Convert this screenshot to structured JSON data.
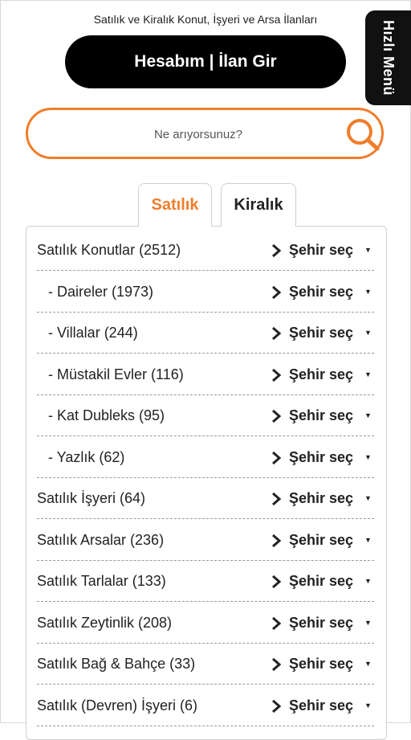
{
  "header": {
    "tagline": "Satılık ve Kiralık Konut, İşyeri ve Arsa İlanları",
    "account_button": "Hesabım | İlan Gir",
    "quick_menu": "Hızlı Menü"
  },
  "search": {
    "placeholder": "Ne arıyorsunuz?",
    "icon": "search-icon"
  },
  "colors": {
    "accent": "#f07d2a",
    "dark": "#000000"
  },
  "tabs": [
    {
      "label": "Satılık",
      "active": true
    },
    {
      "label": "Kiralık",
      "active": false
    }
  ],
  "city_select_label": "Şehir seç",
  "listings": [
    {
      "label": "Satılık Konutlar (2512)",
      "level": "main"
    },
    {
      "label": "- Daireler (1973)",
      "level": "sub"
    },
    {
      "label": "- Villalar (244)",
      "level": "sub"
    },
    {
      "label": "- Müstakil Evler (116)",
      "level": "sub"
    },
    {
      "label": "- Kat Dubleks (95)",
      "level": "sub"
    },
    {
      "label": "- Yazlık (62)",
      "level": "sub"
    },
    {
      "label": "Satılık İşyeri (64)",
      "level": "main"
    },
    {
      "label": "Satılık Arsalar (236)",
      "level": "main"
    },
    {
      "label": "Satılık Tarlalar (133)",
      "level": "main"
    },
    {
      "label": "Satılık Zeytinlik (208)",
      "level": "main"
    },
    {
      "label": "Satılık Bağ & Bahçe (33)",
      "level": "main"
    },
    {
      "label": "Satılık (Devren) İşyeri (6)",
      "level": "main"
    }
  ]
}
